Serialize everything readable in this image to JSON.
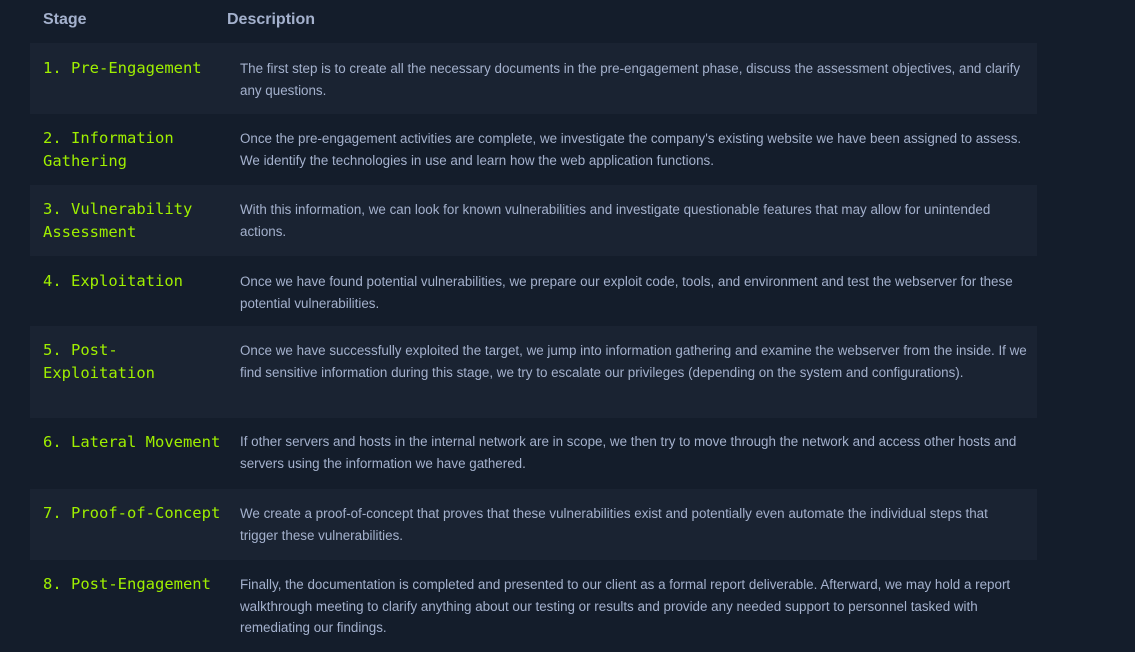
{
  "table": {
    "header": {
      "stage": "Stage",
      "description": "Description"
    },
    "rows": [
      {
        "stage": "1. Pre-Engagement",
        "description": "The first step is to create all the necessary documents in the pre-engagement phase, discuss the assessment objectives, and clarify any questions."
      },
      {
        "stage": "2. Information Gathering",
        "description": "Once the pre-engagement activities are complete, we investigate the company's existing website we have been assigned to assess. We identify the technologies in use and learn how the web application functions."
      },
      {
        "stage": "3. Vulnerability Assessment",
        "description": "With this information, we can look for known vulnerabilities and investigate questionable features that may allow for unintended actions."
      },
      {
        "stage": "4. Exploitation",
        "description": "Once we have found potential vulnerabilities, we prepare our exploit code, tools, and environment and test the webserver for these potential vulnerabilities."
      },
      {
        "stage": "5. Post-Exploitation",
        "description": "Once we have successfully exploited the target, we jump into information gathering and examine the webserver from the inside. If we find sensitive information during this stage, we try to escalate our privileges (depending on the system and configurations)."
      },
      {
        "stage": "6. Lateral Movement",
        "description": "If other servers and hosts in the internal network are in scope, we then try to move through the network and access other hosts and servers using the information we have gathered."
      },
      {
        "stage": "7. Proof-of-Concept",
        "description": "We create a proof-of-concept that proves that these vulnerabilities exist and potentially even automate the individual steps that trigger these vulnerabilities."
      },
      {
        "stage": "8. Post-Engagement",
        "description": "Finally, the documentation is completed and presented to our client as a formal report deliverable. Afterward, we may hold a report walkthrough meeting to clarify anything about our testing or results and provide any needed support to personnel tasked with remediating our findings."
      }
    ]
  },
  "colors": {
    "background": "#141d2b",
    "row_alt": "#1a2332",
    "stage_text": "#9fef00",
    "body_text": "#a4b1cd"
  }
}
